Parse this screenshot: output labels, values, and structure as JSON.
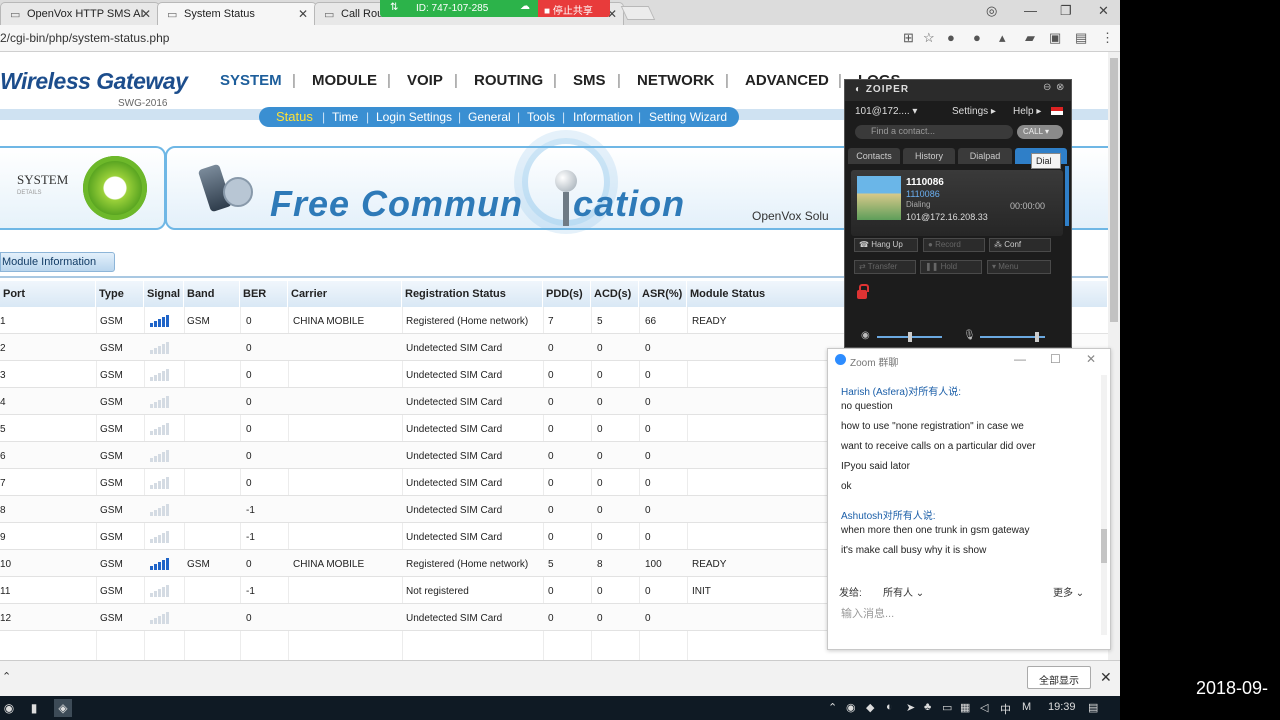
{
  "browser": {
    "tabs": [
      {
        "title": "OpenVox HTTP SMS AI"
      },
      {
        "title": "System Status"
      },
      {
        "title": "Call Rout"
      }
    ],
    "url": "2/cgi-bin/php/system-status.php"
  },
  "share_bar": {
    "id_label": "ID: 747-107-285",
    "stop_label": "停止共享",
    "color": "#2cb34a",
    "stop_color": "#e83b3b"
  },
  "page": {
    "logo": "Wireless Gateway",
    "logo_model": "SWG-2016",
    "nav": [
      "SYSTEM",
      "MODULE",
      "VOIP",
      "ROUTING",
      "SMS",
      "NETWORK",
      "ADVANCED",
      "LOGS"
    ],
    "subnav": [
      "Status",
      "Time",
      "Login Settings",
      "General",
      "Tools",
      "Information",
      "Setting Wizard"
    ],
    "banner_left_title": "SYSTEM",
    "banner_left_sub": "DETAILS",
    "banner_text_a": "Free Commun",
    "banner_text_b": "cation",
    "banner_company": "OpenVox Solu",
    "module_info_label": "Module Information",
    "accent": "#1d5e9b",
    "table": {
      "headers": [
        "Port",
        "Type",
        "Signal",
        "Band",
        "BER",
        "Carrier",
        "Registration Status",
        "PDD(s)",
        "ACD(s)",
        "ASR(%)",
        "Module Status"
      ],
      "rows": [
        {
          "port": "1",
          "type": "GSM",
          "signal": 5,
          "band": "GSM",
          "ber": "0",
          "carrier": "CHINA MOBILE",
          "reg": "Registered (Home network)",
          "pdd": "7",
          "acd": "5",
          "asr": "66",
          "status": "READY"
        },
        {
          "port": "2",
          "type": "GSM",
          "signal": 0,
          "band": "",
          "ber": "0",
          "carrier": "",
          "reg": "Undetected SIM Card",
          "pdd": "0",
          "acd": "0",
          "asr": "0",
          "status": ""
        },
        {
          "port": "3",
          "type": "GSM",
          "signal": 0,
          "band": "",
          "ber": "0",
          "carrier": "",
          "reg": "Undetected SIM Card",
          "pdd": "0",
          "acd": "0",
          "asr": "0",
          "status": ""
        },
        {
          "port": "4",
          "type": "GSM",
          "signal": 0,
          "band": "",
          "ber": "0",
          "carrier": "",
          "reg": "Undetected SIM Card",
          "pdd": "0",
          "acd": "0",
          "asr": "0",
          "status": ""
        },
        {
          "port": "5",
          "type": "GSM",
          "signal": 0,
          "band": "",
          "ber": "0",
          "carrier": "",
          "reg": "Undetected SIM Card",
          "pdd": "0",
          "acd": "0",
          "asr": "0",
          "status": ""
        },
        {
          "port": "6",
          "type": "GSM",
          "signal": 0,
          "band": "",
          "ber": "0",
          "carrier": "",
          "reg": "Undetected SIM Card",
          "pdd": "0",
          "acd": "0",
          "asr": "0",
          "status": ""
        },
        {
          "port": "7",
          "type": "GSM",
          "signal": 0,
          "band": "",
          "ber": "0",
          "carrier": "",
          "reg": "Undetected SIM Card",
          "pdd": "0",
          "acd": "0",
          "asr": "0",
          "status": ""
        },
        {
          "port": "8",
          "type": "GSM",
          "signal": 0,
          "band": "",
          "ber": "-1",
          "carrier": "",
          "reg": "Undetected SIM Card",
          "pdd": "0",
          "acd": "0",
          "asr": "0",
          "status": ""
        },
        {
          "port": "9",
          "type": "GSM",
          "signal": 0,
          "band": "",
          "ber": "-1",
          "carrier": "",
          "reg": "Undetected SIM Card",
          "pdd": "0",
          "acd": "0",
          "asr": "0",
          "status": ""
        },
        {
          "port": "10",
          "type": "GSM",
          "signal": 5,
          "band": "GSM",
          "ber": "0",
          "carrier": "CHINA MOBILE",
          "reg": "Registered (Home network)",
          "pdd": "5",
          "acd": "8",
          "asr": "100",
          "status": "READY"
        },
        {
          "port": "11",
          "type": "GSM",
          "signal": 0,
          "band": "",
          "ber": "-1",
          "carrier": "",
          "reg": "Not registered",
          "pdd": "0",
          "acd": "0",
          "asr": "0",
          "status": "INIT"
        },
        {
          "port": "12",
          "type": "GSM",
          "signal": 0,
          "band": "",
          "ber": "0",
          "carrier": "",
          "reg": "Undetected SIM Card",
          "pdd": "0",
          "acd": "0",
          "asr": "0",
          "status": ""
        }
      ]
    }
  },
  "download_bar": {
    "show_all": "全部显示"
  },
  "zoiper": {
    "title": "ZOIPER",
    "account": "101@172....",
    "settings": "Settings",
    "help": "Help",
    "find_placeholder": "Find a contact...",
    "call_label": "CALL",
    "tabs": [
      "Contacts",
      "History",
      "Dialpad",
      "Dial"
    ],
    "tooltip": "Dial",
    "call": {
      "number": "1110086",
      "number2": "1110086",
      "state": "Dialing",
      "address": "101@172.16.208.33",
      "timer": "00:00:00"
    },
    "buttons": [
      "Hang Up",
      "Record",
      "Conf",
      "Transfer",
      "Hold",
      "Menu"
    ]
  },
  "zoom_chat": {
    "title": "Zoom 群聊",
    "messages": [
      {
        "sender": "Harish (Asfera)对所有人说:",
        "lines": [
          "no question",
          "how to use \"none registration\" in case we",
          "want to receive calls on a particular did over",
          "IPyou said lator",
          "ok"
        ]
      },
      {
        "sender": "Ashutosh对所有人说:",
        "lines": [
          "when more then one trunk in gsm gateway",
          "it's make call busy why it is show"
        ]
      }
    ],
    "send_to_label": "发给:",
    "send_to_value": "所有人",
    "more_label": "更多",
    "input_placeholder": "输入消息..."
  },
  "taskbar": {
    "clock": "19:39",
    "ime": "中",
    "overlay_date": "2018-09-"
  }
}
